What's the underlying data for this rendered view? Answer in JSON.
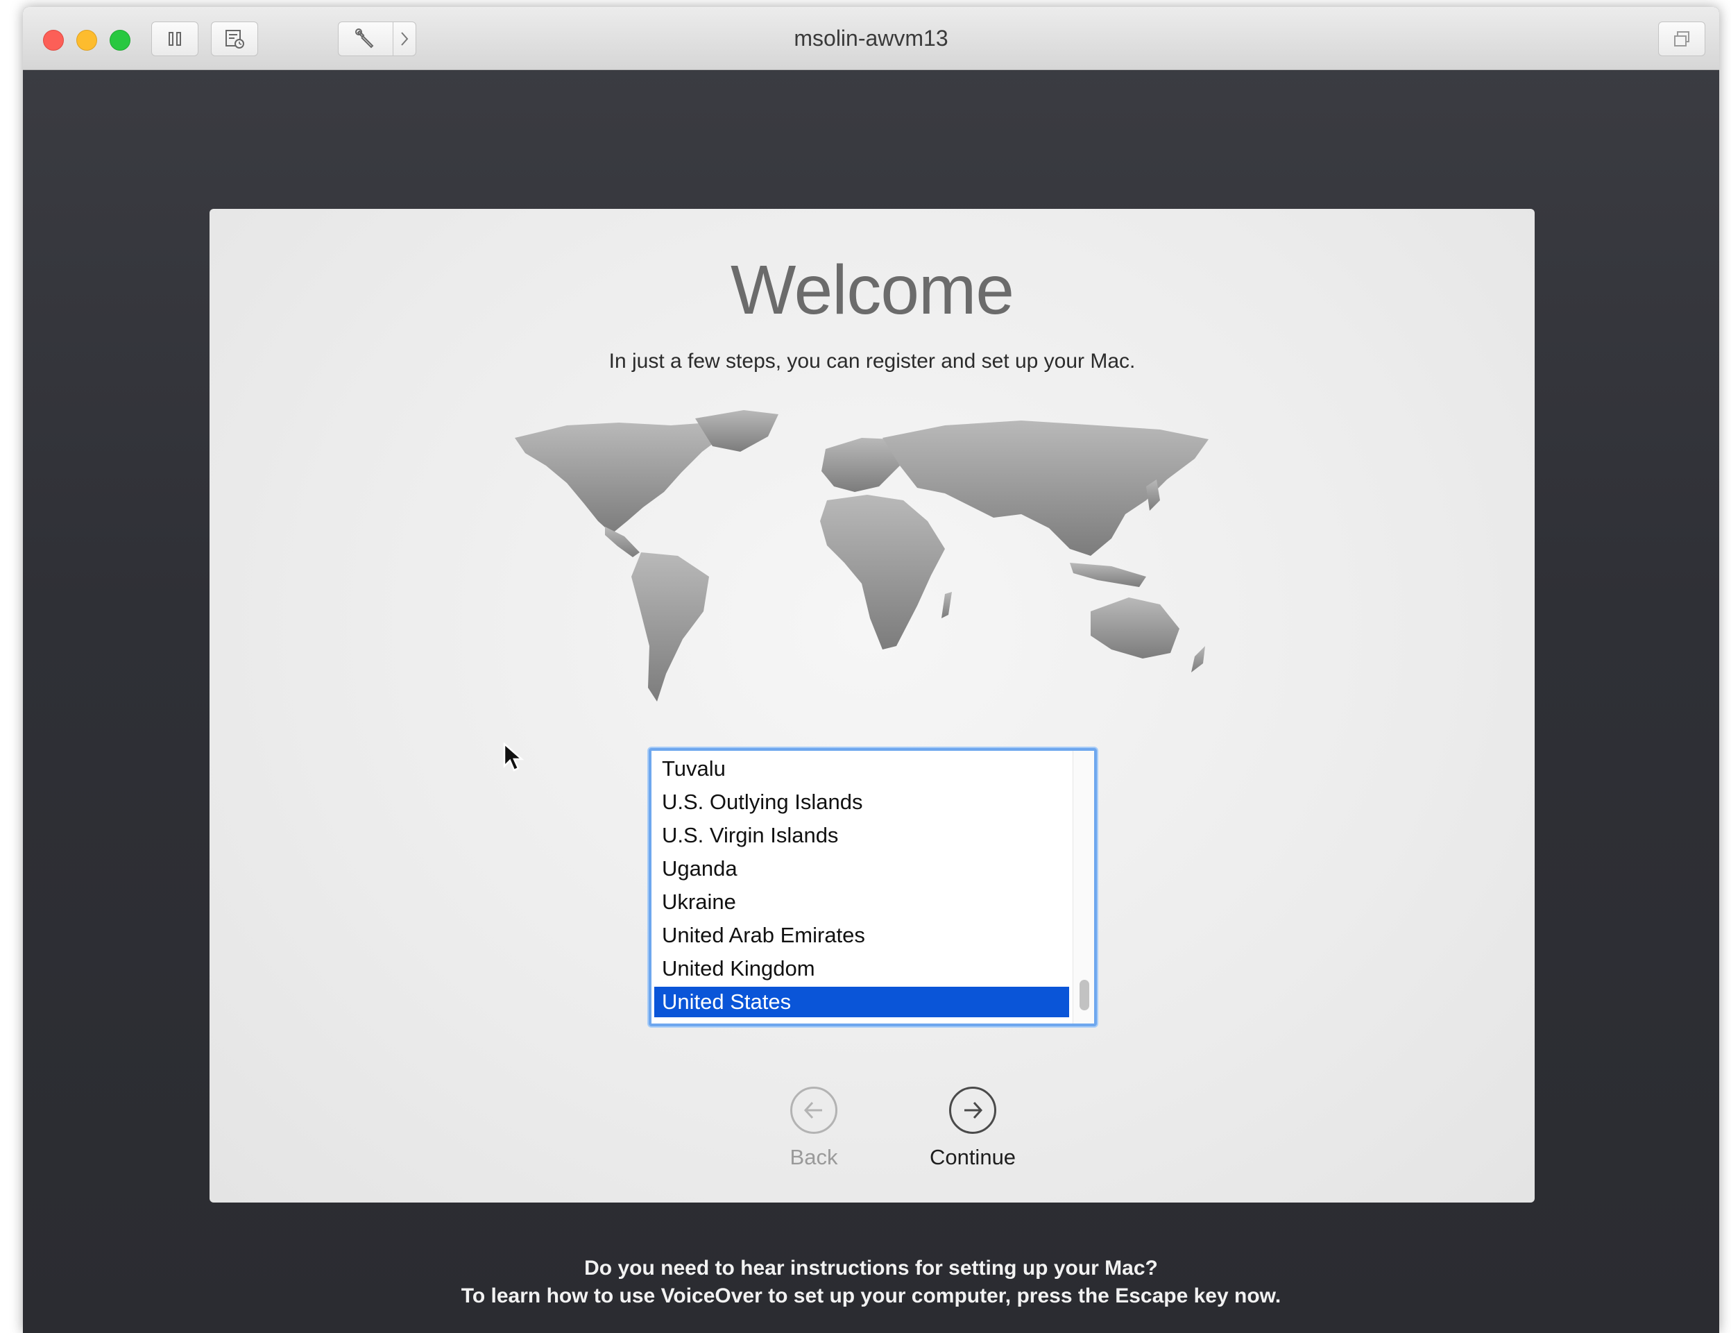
{
  "window": {
    "title": "msolin-awvm13"
  },
  "toolbar": {
    "icons": [
      "pause-icon",
      "snapshot-icon",
      "wrench-icon",
      "chevron-right-icon",
      "restore-window-icon"
    ]
  },
  "setup": {
    "title": "Welcome",
    "subtitle": "In just a few steps, you can register and set up your Mac.",
    "countries": [
      "Tuvalu",
      "U.S. Outlying Islands",
      "U.S. Virgin Islands",
      "Uganda",
      "Ukraine",
      "United Arab Emirates",
      "United Kingdom",
      "United States"
    ],
    "selected_country": "United States",
    "back_label": "Back",
    "continue_label": "Continue"
  },
  "voiceover": {
    "line1": "Do you need to hear instructions for setting up your Mac?",
    "line2": "To learn how to use VoiceOver to set up your computer, press the Escape key now."
  },
  "colors": {
    "selection": "#0a55d8",
    "focus_ring": "#6ea7ee",
    "close": "#fc5f57",
    "minimize": "#fdbc2e",
    "maximize": "#28c840"
  }
}
